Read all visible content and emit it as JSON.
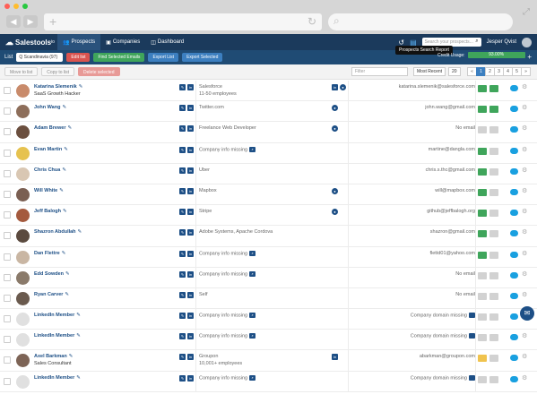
{
  "browser": {
    "colors": {
      "red": "#ff5f57",
      "yellow": "#ffbd2e",
      "green": "#28c940"
    },
    "back_icon": "back-arrow-icon",
    "forward_icon": "forward-arrow-icon",
    "reload_icon": "reload-icon"
  },
  "topnav": {
    "brand": "Salestools",
    "brand_suffix": "io",
    "tabs": [
      {
        "label": "Prospects",
        "icon": "people-icon",
        "active": true
      },
      {
        "label": "Companies",
        "icon": "building-icon",
        "active": false
      },
      {
        "label": "Dashboard",
        "icon": "dashboard-icon",
        "active": false
      }
    ],
    "search_placeholder": "Search your prospects...",
    "user": "Jesper Qvist"
  },
  "toolbar": {
    "list_label": "List",
    "list_value": "Q Scandinavia (97)",
    "edit_list": "Edit list",
    "find_emails": "Find Selected Emails",
    "export_list": "Export List",
    "export_selected": "Export Selected",
    "tooltip": "Prospects Search Report",
    "credit_label": "Credit Usage:",
    "credit_value": "93.00%"
  },
  "toolbar2": {
    "move_to_list": "Move to list",
    "copy_to_list": "Copy to list",
    "delete_selected": "Delete selected",
    "filter_placeholder": "Filter",
    "sort": "Most Recent",
    "per_page": "20",
    "pages": [
      "«",
      "1",
      "2",
      "3",
      "4",
      "5",
      "»"
    ]
  },
  "rows": [
    {
      "name": "Katarina Slemenik",
      "title": "SaaS Growth Hacker",
      "avatar": "#c98b6b",
      "company": "Salesforce",
      "sub": "11-50 employees",
      "co_icons": [
        "in",
        "globe"
      ],
      "email": "katarina.slemenik@salesforce.com",
      "actions": [
        "green",
        "green"
      ]
    },
    {
      "name": "John Wang",
      "title": "",
      "avatar": "#8d6e5a",
      "company": "Twitter.com",
      "sub": "",
      "co_icons": [
        "globe"
      ],
      "email": "john.wang@gmail.com",
      "actions": [
        "green",
        "green"
      ]
    },
    {
      "name": "Adam Brewer",
      "title": "",
      "avatar": "#6b4f3f",
      "company": "Freelance Web Developer",
      "sub": "",
      "co_icons": [
        "globe"
      ],
      "email": "No email",
      "actions": [
        "grey",
        "grey"
      ]
    },
    {
      "name": "Evan Martin",
      "title": "",
      "avatar": "#e6c24f",
      "company": "Company info missing",
      "sub": "",
      "missing": true,
      "co_icons": [],
      "email": "martine@dangla.com",
      "actions": [
        "green",
        "grey"
      ]
    },
    {
      "name": "Chris Chua",
      "title": "",
      "avatar": "#d9c7b3",
      "company": "Uber",
      "sub": "",
      "co_icons": [],
      "email": "chris.s.thc@gmail.com",
      "actions": [
        "green",
        "grey"
      ]
    },
    {
      "name": "Will White",
      "title": "",
      "avatar": "#7a5f52",
      "company": "Mapbox",
      "sub": "",
      "co_icons": [
        "globe"
      ],
      "email": "will@mapbox.com",
      "actions": [
        "green",
        "grey"
      ]
    },
    {
      "name": "Jeff Balogh",
      "title": "",
      "avatar": "#a45a3e",
      "company": "Stripe",
      "sub": "",
      "co_icons": [
        "globe"
      ],
      "email": "github@jeffbalogh.org",
      "actions": [
        "green",
        "grey"
      ]
    },
    {
      "name": "Shazron Abdullah",
      "title": "",
      "avatar": "#5b4a3f",
      "company": "Adobe Systems, Apache Cordova",
      "sub": "",
      "co_icons": [],
      "email": "shazron@gmail.com",
      "actions": [
        "green",
        "grey"
      ]
    },
    {
      "name": "Dan Flettre",
      "title": "",
      "avatar": "#c9b6a3",
      "company": "Company info missing",
      "sub": "",
      "missing": true,
      "co_icons": [],
      "email": "flettd01@yahoo.com",
      "actions": [
        "green",
        "grey"
      ]
    },
    {
      "name": "Edd Sowden",
      "title": "",
      "avatar": "#8a7a6a",
      "company": "Company info missing",
      "sub": "",
      "missing": true,
      "co_icons": [],
      "email": "No email",
      "actions": [
        "grey",
        "grey"
      ]
    },
    {
      "name": "Ryan Carver",
      "title": "",
      "avatar": "#6a5a4e",
      "company": "Self",
      "sub": "",
      "co_icons": [],
      "email": "No email",
      "actions": [
        "grey",
        "grey"
      ]
    },
    {
      "name": "LinkedIn Member",
      "title": "",
      "avatar": "",
      "company": "Company info missing",
      "sub": "",
      "missing": true,
      "co_icons": [],
      "email": "Company domain missing",
      "domain_missing": true,
      "actions": [
        "grey",
        "grey"
      ]
    },
    {
      "name": "LinkedIn Member",
      "title": "",
      "avatar": "",
      "company": "Company info missing",
      "sub": "",
      "missing": true,
      "co_icons": [],
      "email": "Company domain missing",
      "domain_missing": true,
      "actions": [
        "grey",
        "grey"
      ]
    },
    {
      "name": "Axel Barkman",
      "title": "Sales Consultant",
      "avatar": "#7d6456",
      "company": "Groupon",
      "sub": "10,001+ employees",
      "co_icons": [
        "in"
      ],
      "email": "abarkman@groupon.com",
      "actions": [
        "yellow",
        "grey"
      ]
    },
    {
      "name": "LinkedIn Member",
      "title": "",
      "avatar": "",
      "company": "Company info missing",
      "sub": "",
      "missing": true,
      "co_icons": [],
      "email": "Company domain missing",
      "domain_missing": true,
      "actions": [
        "grey",
        "grey"
      ]
    }
  ],
  "chat_icon": "chat-bubble-icon"
}
